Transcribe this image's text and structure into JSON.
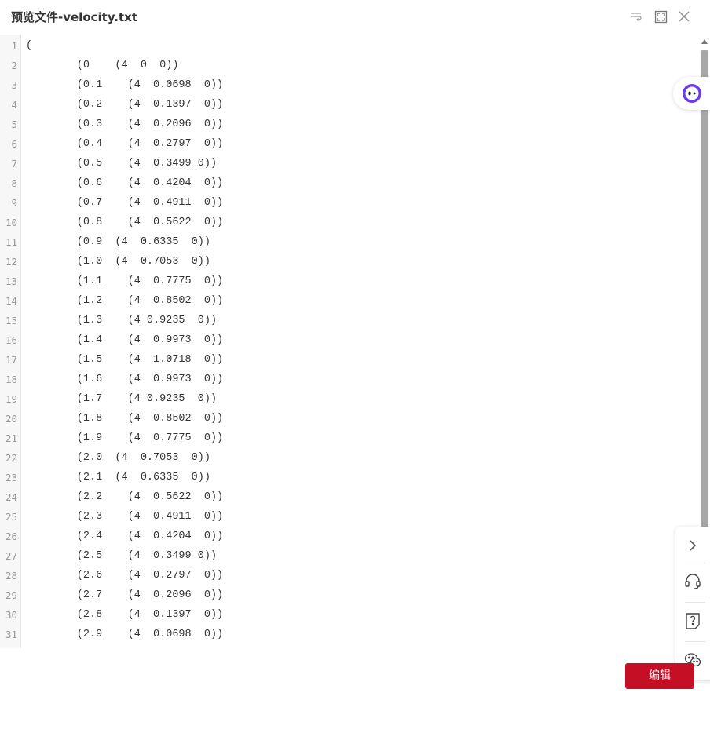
{
  "header": {
    "title": "预览文件-velocity.txt",
    "icons": [
      "wrap-icon",
      "fullscreen-icon",
      "close-icon"
    ]
  },
  "file": {
    "lines": [
      {
        "n": "1",
        "text": "("
      },
      {
        "n": "2",
        "text": "        (0    (4  0  0))"
      },
      {
        "n": "3",
        "text": "        (0.1    (4  0.0698  0))"
      },
      {
        "n": "4",
        "text": "        (0.2    (4  0.1397  0))"
      },
      {
        "n": "5",
        "text": "        (0.3    (4  0.2096  0))"
      },
      {
        "n": "6",
        "text": "        (0.4    (4  0.2797  0))"
      },
      {
        "n": "7",
        "text": "        (0.5    (4  0.3499 0))"
      },
      {
        "n": "8",
        "text": "        (0.6    (4  0.4204  0))"
      },
      {
        "n": "9",
        "text": "        (0.7    (4  0.4911  0))"
      },
      {
        "n": "10",
        "text": "        (0.8    (4  0.5622  0))"
      },
      {
        "n": "11",
        "text": "        (0.9  (4  0.6335  0))"
      },
      {
        "n": "12",
        "text": "        (1.0  (4  0.7053  0))"
      },
      {
        "n": "13",
        "text": "        (1.1    (4  0.7775  0))"
      },
      {
        "n": "14",
        "text": "        (1.2    (4  0.8502  0))"
      },
      {
        "n": "15",
        "text": "        (1.3    (4 0.9235  0))"
      },
      {
        "n": "16",
        "text": "        (1.4    (4  0.9973  0))"
      },
      {
        "n": "17",
        "text": "        (1.5    (4  1.0718  0))"
      },
      {
        "n": "18",
        "text": "        (1.6    (4  0.9973  0))"
      },
      {
        "n": "19",
        "text": "        (1.7    (4 0.9235  0))"
      },
      {
        "n": "20",
        "text": "        (1.8    (4  0.8502  0))"
      },
      {
        "n": "21",
        "text": "        (1.9    (4  0.7775  0))"
      },
      {
        "n": "22",
        "text": "        (2.0  (4  0.7053  0))"
      },
      {
        "n": "23",
        "text": "        (2.1  (4  0.6335  0))"
      },
      {
        "n": "24",
        "text": "        (2.2    (4  0.5622  0))"
      },
      {
        "n": "25",
        "text": "        (2.3    (4  0.4911  0))"
      },
      {
        "n": "26",
        "text": "        (2.4    (4  0.4204  0))"
      },
      {
        "n": "27",
        "text": "        (2.5    (4  0.3499 0))"
      },
      {
        "n": "28",
        "text": "        (2.6    (4  0.2797  0))"
      },
      {
        "n": "29",
        "text": "        (2.7    (4  0.2096  0))"
      },
      {
        "n": "30",
        "text": "        (2.8    (4  0.1397  0))"
      },
      {
        "n": "31",
        "text": "        (2.9    (4  0.0698  0))"
      }
    ]
  },
  "side_panel": {
    "icons": [
      "chevron-right-icon",
      "headset-icon",
      "help-doc-icon",
      "wechat-icon"
    ]
  },
  "assistant": {
    "icon": "assistant-face-icon"
  },
  "footer": {
    "edit_label": "编辑"
  },
  "colors": {
    "accent": "#c40f24",
    "assistant": "#6a3cf0"
  }
}
